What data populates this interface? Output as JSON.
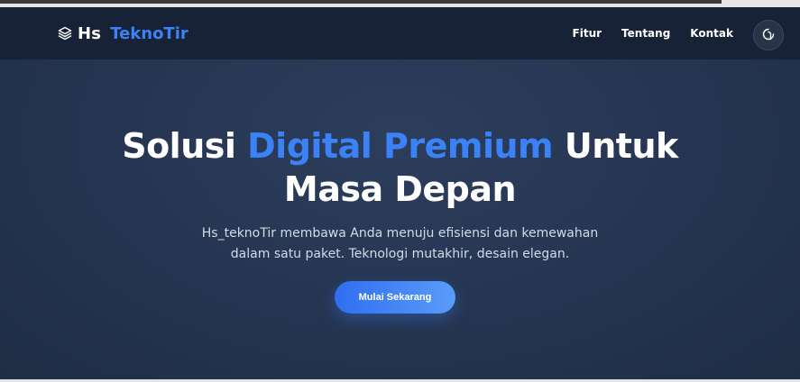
{
  "navbar": {
    "brand": {
      "icon": "layers-icon",
      "prefix": "Hs",
      "name": "TeknoTir"
    },
    "links": [
      {
        "label": "Fitur"
      },
      {
        "label": "Tentang"
      },
      {
        "label": "Kontak"
      }
    ],
    "theme_toggle_icon": "moon-icon"
  },
  "hero": {
    "title_part1": "Solusi",
    "title_accent": "Digital Premium",
    "title_part2": "Untuk",
    "title_line2": "Masa Depan",
    "subtitle_line1": "Hs_teknoTir membawa Anda menuju efisiensi dan kemewahan",
    "subtitle_line2": "dalam satu paket. Teknologi mutakhir, desain elegan.",
    "cta_label": "Mulai Sekarang"
  },
  "colors": {
    "accent": "#3b82f6",
    "navbar_bg": "#172236",
    "hero_bg": "#273754",
    "text_primary": "#ffffff",
    "text_muted": "#d3dbe8"
  }
}
